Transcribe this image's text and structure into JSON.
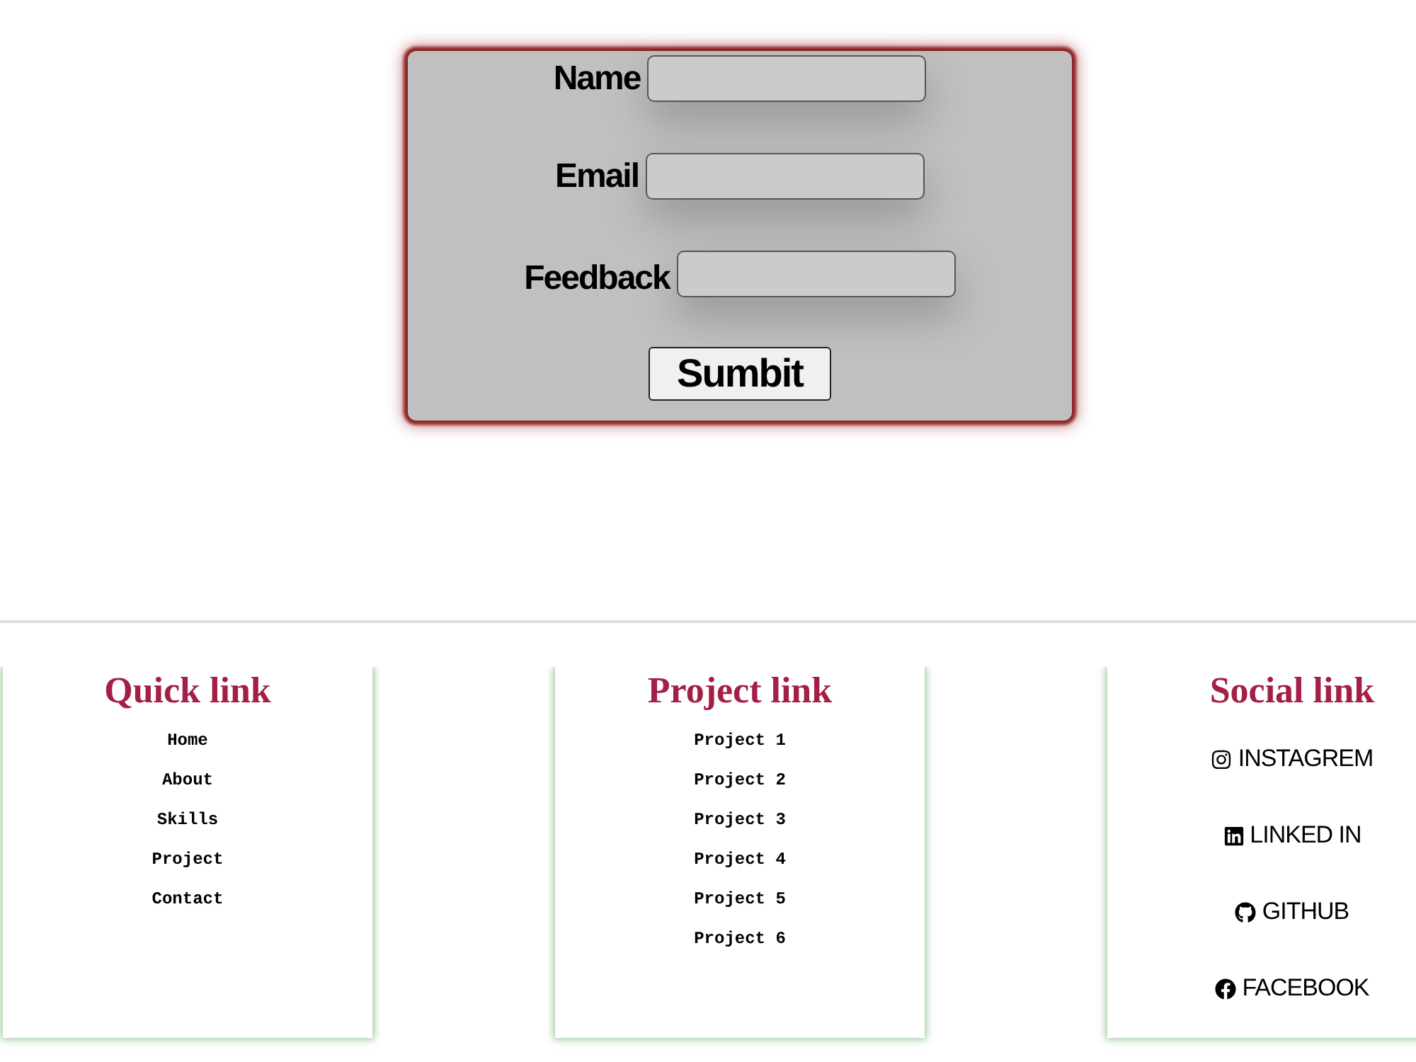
{
  "form": {
    "fields": [
      {
        "label": "Name",
        "kind": "input"
      },
      {
        "label": "Email",
        "kind": "input"
      },
      {
        "label": "Feedback",
        "kind": "textarea"
      }
    ],
    "submit": "Sumbit"
  },
  "footer": {
    "sections": [
      {
        "title": "Quick link",
        "kind": "text",
        "links": [
          "Home",
          "About",
          "Skills",
          "Project",
          "Contact"
        ]
      },
      {
        "title": "Project link",
        "kind": "text",
        "links": [
          "Project 1",
          "Project 2",
          "Project 3",
          "Project 4",
          "Project 5",
          "Project 6"
        ]
      },
      {
        "title": "Social link",
        "kind": "social",
        "links": [
          "INSTAGREM",
          "LINKED IN",
          "GITHUB",
          "FACEBOOK"
        ]
      }
    ]
  }
}
